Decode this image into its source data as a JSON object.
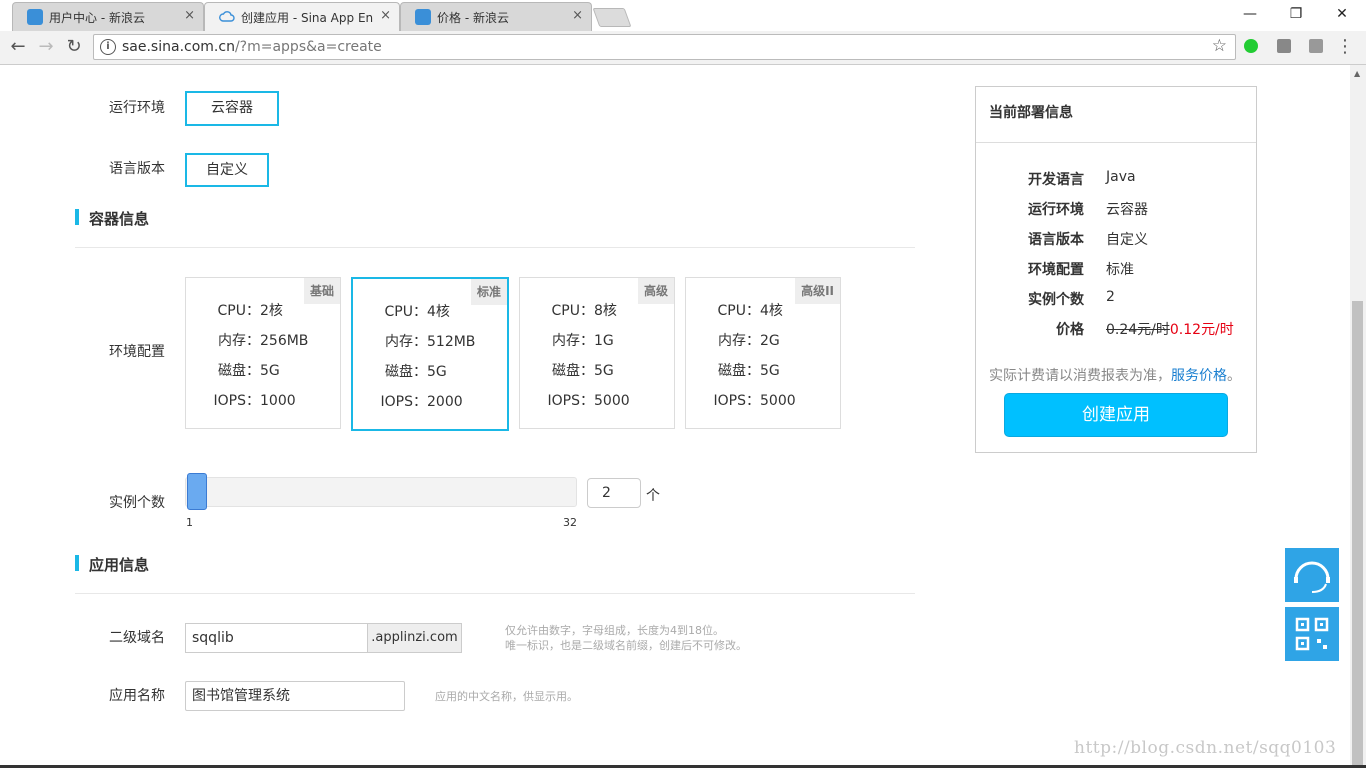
{
  "browser": {
    "tabs": [
      {
        "title": "用户中心 - 新浪云",
        "close": "×",
        "icon": "sina-cloud-icon"
      },
      {
        "title": "创建应用 - Sina App En",
        "close": "×",
        "icon": "cloud-icon"
      },
      {
        "title": "价格 - 新浪云",
        "close": "×",
        "icon": "sina-cloud-icon"
      }
    ],
    "url_host": "sae.sina.com.cn",
    "url_path": "/?m=apps&a=create",
    "window_buttons": {
      "minimize": "—",
      "restore": "❐",
      "close": "✕"
    },
    "nav": {
      "back": "←",
      "forward": "→",
      "reload": "↻"
    }
  },
  "form": {
    "runtime_label": "运行环境",
    "runtime_value": "云容器",
    "lang_version_label": "语言版本",
    "lang_version_value": "自定义",
    "container_section": "容器信息",
    "env_config_label": "环境配置",
    "plans": [
      {
        "tag": "基础",
        "cpu_k": "CPU：",
        "cpu": "2核",
        "mem_k": "内存：",
        "mem": "256MB",
        "disk_k": "磁盘：",
        "disk": "5G",
        "iops_k": "IOPS：",
        "iops": "1000",
        "selected": false
      },
      {
        "tag": "标准",
        "cpu_k": "CPU：",
        "cpu": "4核",
        "mem_k": "内存：",
        "mem": "512MB",
        "disk_k": "磁盘：",
        "disk": "5G",
        "iops_k": "IOPS：",
        "iops": "2000",
        "selected": true
      },
      {
        "tag": "高级",
        "cpu_k": "CPU：",
        "cpu": "8核",
        "mem_k": "内存：",
        "mem": "1G",
        "disk_k": "磁盘：",
        "disk": "5G",
        "iops_k": "IOPS：",
        "iops": "5000",
        "selected": false
      },
      {
        "tag": "高级II",
        "cpu_k": "CPU：",
        "cpu": "4核",
        "mem_k": "内存：",
        "mem": "2G",
        "disk_k": "磁盘：",
        "disk": "5G",
        "iops_k": "IOPS：",
        "iops": "5000",
        "selected": false
      }
    ],
    "instances_label": "实例个数",
    "instances_value": "2",
    "instances_unit": "个",
    "slider_min": "1",
    "slider_max": "32",
    "app_section": "应用信息",
    "subdomain_label": "二级域名",
    "subdomain_value": "sqqlib",
    "subdomain_suffix": ".applinzi.com",
    "subdomain_hint1": "仅允许由数字，字母组成，长度为4到18位。",
    "subdomain_hint2": "唯一标识，也是二级域名前缀，创建后不可修改。",
    "appname_label": "应用名称",
    "appname_value": "图书馆管理系统",
    "appname_hint": "应用的中文名称，供显示用。"
  },
  "summary": {
    "title": "当前部署信息",
    "rows": [
      {
        "k": "开发语言",
        "v": "Java"
      },
      {
        "k": "运行环境",
        "v": "云容器"
      },
      {
        "k": "语言版本",
        "v": "自定义"
      },
      {
        "k": "环境配置",
        "v": "标准"
      },
      {
        "k": "实例个数",
        "v": "2"
      }
    ],
    "price_label": "价格",
    "price_old": "0.24元/时",
    "price_new": "0.12元/时",
    "note_text": "实际计费请以消费报表为准，",
    "note_link": "服务价格",
    "note_end": "。",
    "create_button": "创建应用"
  },
  "watermark": "http://blog.csdn.net/sqq0103",
  "colors": {
    "accent": "#1ab8e6",
    "button": "#00c0ff",
    "price_red": "#e60012",
    "float": "#2fa4e6"
  }
}
